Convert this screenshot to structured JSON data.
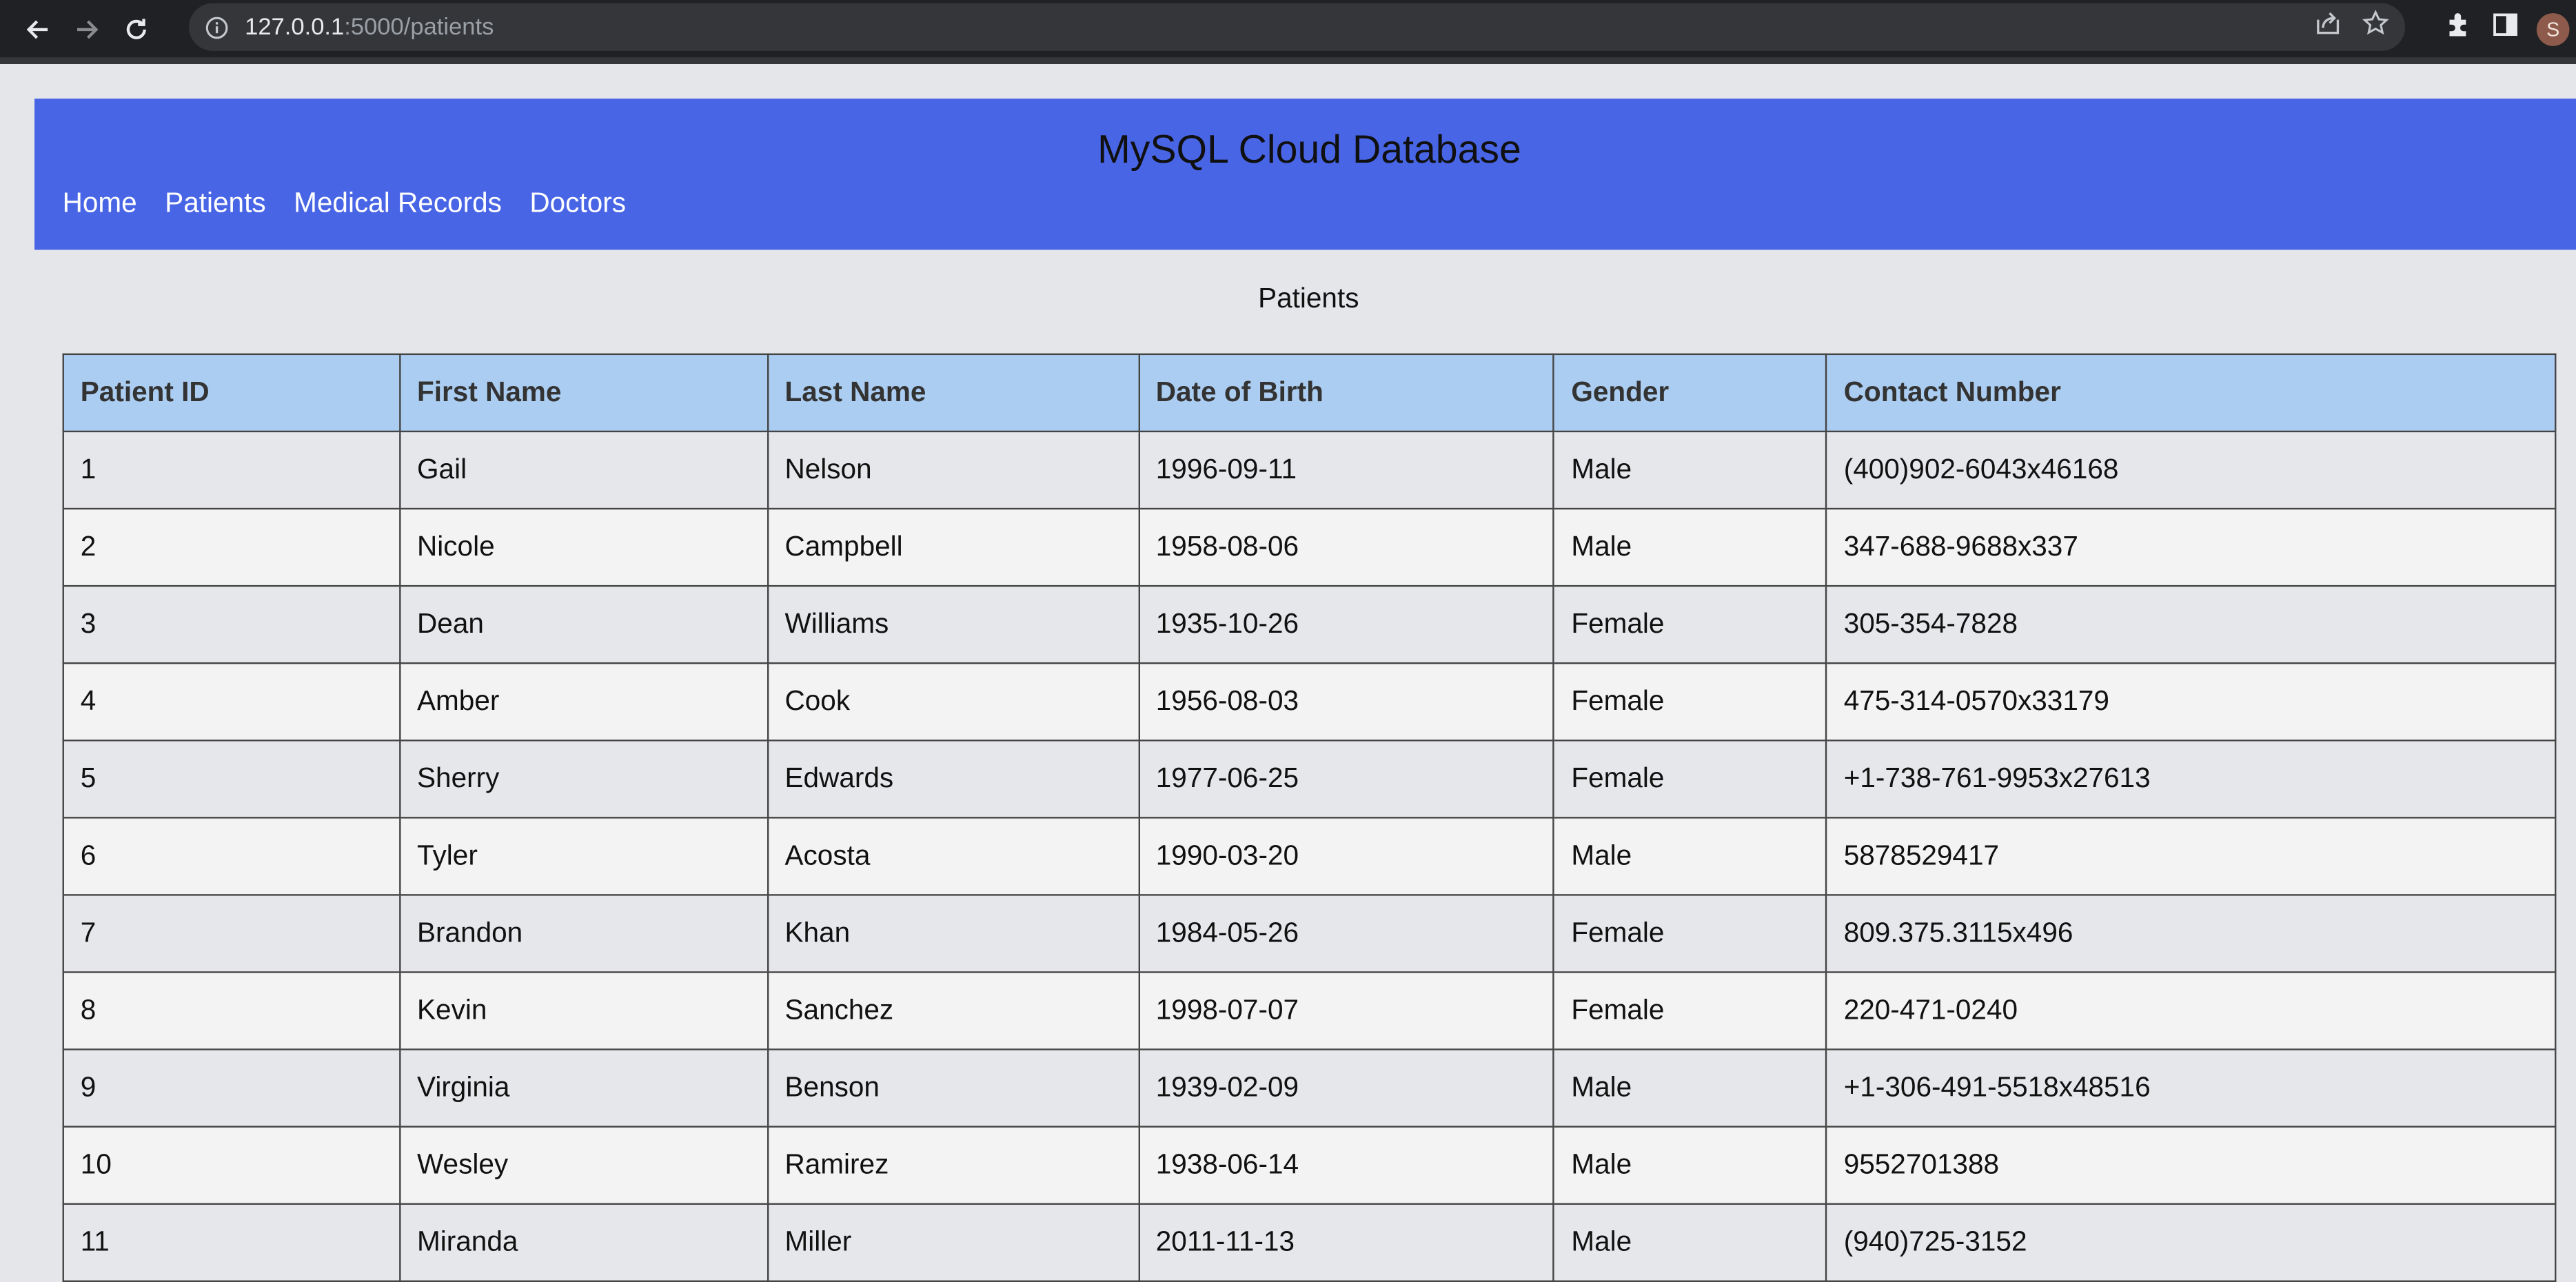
{
  "browser": {
    "url_host": "127.0.0.1",
    "url_path": ":5000/patients",
    "profile_initial": "S"
  },
  "site": {
    "title": "MySQL Cloud Database",
    "nav": [
      "Home",
      "Patients",
      "Medical Records",
      "Doctors"
    ]
  },
  "page": {
    "heading": "Patients"
  },
  "table": {
    "columns": [
      "Patient ID",
      "First Name",
      "Last Name",
      "Date of Birth",
      "Gender",
      "Contact Number"
    ],
    "rows": [
      [
        "1",
        "Gail",
        "Nelson",
        "1996-09-11",
        "Male",
        "(400)902-6043x46168"
      ],
      [
        "2",
        "Nicole",
        "Campbell",
        "1958-08-06",
        "Male",
        "347-688-9688x337"
      ],
      [
        "3",
        "Dean",
        "Williams",
        "1935-10-26",
        "Female",
        "305-354-7828"
      ],
      [
        "4",
        "Amber",
        "Cook",
        "1956-08-03",
        "Female",
        "475-314-0570x33179"
      ],
      [
        "5",
        "Sherry",
        "Edwards",
        "1977-06-25",
        "Female",
        "+1-738-761-9953x27613"
      ],
      [
        "6",
        "Tyler",
        "Acosta",
        "1990-03-20",
        "Male",
        "5878529417"
      ],
      [
        "7",
        "Brandon",
        "Khan",
        "1984-05-26",
        "Female",
        "809.375.3115x496"
      ],
      [
        "8",
        "Kevin",
        "Sanchez",
        "1998-07-07",
        "Female",
        "220-471-0240"
      ],
      [
        "9",
        "Virginia",
        "Benson",
        "1939-02-09",
        "Male",
        "+1-306-491-5518x48516"
      ],
      [
        "10",
        "Wesley",
        "Ramirez",
        "1938-06-14",
        "Male",
        "9552701388"
      ],
      [
        "11",
        "Miranda",
        "Miller",
        "2011-11-13",
        "Male",
        "(940)725-3152"
      ]
    ]
  },
  "colors": {
    "header_bg": "#4865e6",
    "table_header_bg": "#abcdf1",
    "page_bg": "#e5e6ea"
  }
}
